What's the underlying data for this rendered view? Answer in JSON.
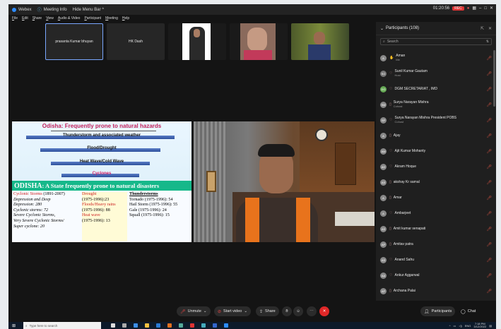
{
  "window": {
    "menu_items": [
      "Webex",
      "Meeting Info",
      "Hide Menu Bar ^"
    ],
    "time": "01:20:56",
    "rec": "REC",
    "controls": [
      "–",
      "□",
      "✕"
    ]
  },
  "menubar": [
    "File",
    "Edit",
    "Share",
    "View",
    "Audio & Video",
    "Participant",
    "Meeting",
    "Help"
  ],
  "thumbnails": [
    {
      "label": "prasanta Kumar bhuyan",
      "selected": true
    },
    {
      "label": "HK Dash",
      "selected": false
    }
  ],
  "slide": {
    "title": "Odisha: Frequently prone to natural hazards",
    "items": [
      "Thunderstorm and associated weather",
      "Flood/Drought",
      "Heat Wave/Cold Wave",
      "Cyclones"
    ],
    "banner_big": "ODISHA",
    "banner_rest": ": A State frequently prone to natural  disasters",
    "col1_head": "Cyclonic Storms",
    "col1_head_years": " (1891-2007)",
    "col1_lines": [
      "Depression and Deep",
      "Depression: 280",
      "Cyclonic storms: 72",
      "Severe Cyclonic Storms,",
      "Very Severe Cyclonic Storms/",
      "Super cyclone: 20"
    ],
    "col2_head": "Drought",
    "col2_l1": "(1975-1996):23",
    "col2_flood": "Floods/Heavy rains",
    "col2_l2": "(1975-1996): 88",
    "col2_heat": "Heat wave",
    "col2_l3": "(1975-1996): 13",
    "col3_head": "Thunderstorms",
    "col3_lines": [
      "Tornado (1975-1996): 54",
      "Hail Storm (1975-1996): 55",
      "Gale (1975-1996): 24",
      "Squall (1975-1996): 15"
    ]
  },
  "participants": {
    "header": "Participants (108)",
    "search_placeholder": "Search",
    "list": [
      {
        "initials": "A",
        "name": "Aman",
        "role": "Me",
        "color": "#8a8a8a",
        "hand": "✋"
      },
      {
        "initials": "SG",
        "name": "Sunil Kumar Gautam",
        "role": "Host",
        "color": "#777",
        "hand": "♡"
      },
      {
        "initials": "DG",
        "name": "DGM SECRETARIAT , IMD",
        "role": "",
        "color": "#6a5",
        "hand": "♡"
      },
      {
        "initials": "SM",
        "name": "Surya Narayan Mishra",
        "role": "Cohost",
        "color": "#888",
        "hand": "▯"
      },
      {
        "initials": "SP",
        "name": "Surya Narayan Mishra President POBS",
        "role": "Cohost",
        "color": "#888",
        "hand": "♡"
      },
      {
        "initials": "A",
        "name": "Ajay",
        "role": "",
        "color": "#888",
        "hand": "▯"
      },
      {
        "initials": "AM",
        "name": "Ajit Kumar Mohanty",
        "role": "",
        "color": "#888",
        "hand": "♡"
      },
      {
        "initials": "AH",
        "name": "Akram Hoque",
        "role": "",
        "color": "#888",
        "hand": "♡"
      },
      {
        "initials": "AS",
        "name": "akshay Kr samal",
        "role": "",
        "color": "#888",
        "hand": "▯"
      },
      {
        "initials": "A",
        "name": "Amar",
        "role": "",
        "color": "#888",
        "hand": "▯"
      },
      {
        "initials": "A",
        "name": "Ambarjeet",
        "role": "",
        "color": "#888",
        "hand": "♡"
      },
      {
        "initials": "AS",
        "name": "Amit kumar senapati",
        "role": "",
        "color": "#888",
        "hand": "▯"
      },
      {
        "initials": "AP",
        "name": "Amitav patra",
        "role": "",
        "color": "#888",
        "hand": "▯"
      },
      {
        "initials": "AS",
        "name": "Anand Sahu",
        "role": "",
        "color": "#888",
        "hand": "♡"
      },
      {
        "initials": "AA",
        "name": "Ankur Aggarwal",
        "role": "",
        "color": "#888",
        "hand": "♡"
      },
      {
        "initials": "AP",
        "name": "Archana Palai",
        "role": "",
        "color": "#888",
        "hand": "▯"
      }
    ]
  },
  "toolbar": {
    "unmute": "Unmute",
    "start_video": "Start video",
    "share": "Share",
    "participants": "Participants",
    "chat": "Chat"
  },
  "taskbar": {
    "search": "Type here to search",
    "time": "7:18 PM",
    "date": "3/12/2022",
    "lang": "ENG"
  }
}
